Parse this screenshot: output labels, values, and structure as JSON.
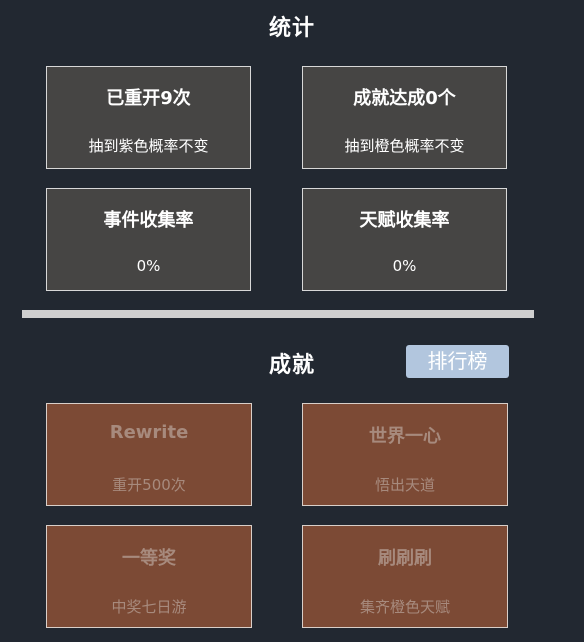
{
  "stats": {
    "title": "统计",
    "cards": [
      {
        "title": "已重开9次",
        "sub": "抽到紫色概率不变"
      },
      {
        "title": "成就达成0个",
        "sub": "抽到橙色概率不变"
      },
      {
        "title": "事件收集率",
        "sub": "0%"
      },
      {
        "title": "天赋收集率",
        "sub": "0%"
      }
    ]
  },
  "achievements": {
    "title": "成就",
    "rank_button": "排行榜",
    "cards": [
      {
        "title": "Rewrite",
        "sub": "重开500次"
      },
      {
        "title": "世界一心",
        "sub": "悟出天道"
      },
      {
        "title": "一等奖",
        "sub": "中奖七日游"
      },
      {
        "title": "刷刷刷",
        "sub": "集齐橙色天赋"
      }
    ]
  },
  "colors": {
    "background": "#222831",
    "stat_card": "#464544",
    "achievement_card_locked": "#7c4a35",
    "rank_button": "#b2c6de"
  }
}
